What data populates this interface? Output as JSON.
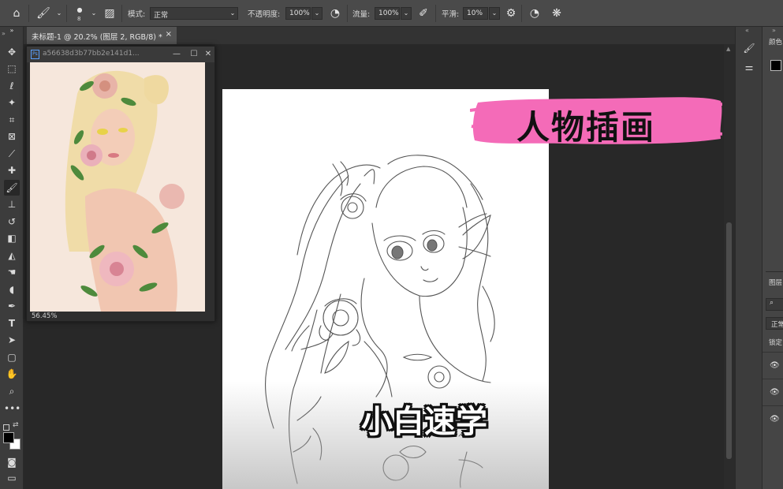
{
  "options_bar": {
    "brush_size": "8",
    "mode_label": "模式:",
    "mode_value": "正常",
    "opacity_label": "不透明度:",
    "opacity_value": "100%",
    "flow_label": "流量:",
    "flow_value": "100%",
    "smoothing_label": "平滑:",
    "smoothing_value": "10%"
  },
  "document_tab": {
    "title": "未标题-1 @ 20.2% (图层 2, RGB/8) *",
    "close": "×"
  },
  "float_window": {
    "title": "a56638d3b77bb2e141d1...",
    "ps_badge": "Ps",
    "minimize": "—",
    "restore": "☐",
    "close": "✕",
    "zoom": "56.45%"
  },
  "right_panel": {
    "color_title": "颜色",
    "layers_title": "图层",
    "blend_mode": "正常",
    "lock_label": "锁定"
  },
  "overlays": {
    "badge_text": "人物插画",
    "subtitle": "小白速学"
  },
  "colors": {
    "badge_pink": "#f46bb8",
    "foreground": "#000000",
    "background": "#ffffff"
  },
  "icons": {
    "home": "home-icon",
    "brush": "brush-icon",
    "settings": "gear-icon",
    "eye": "eye-icon"
  }
}
